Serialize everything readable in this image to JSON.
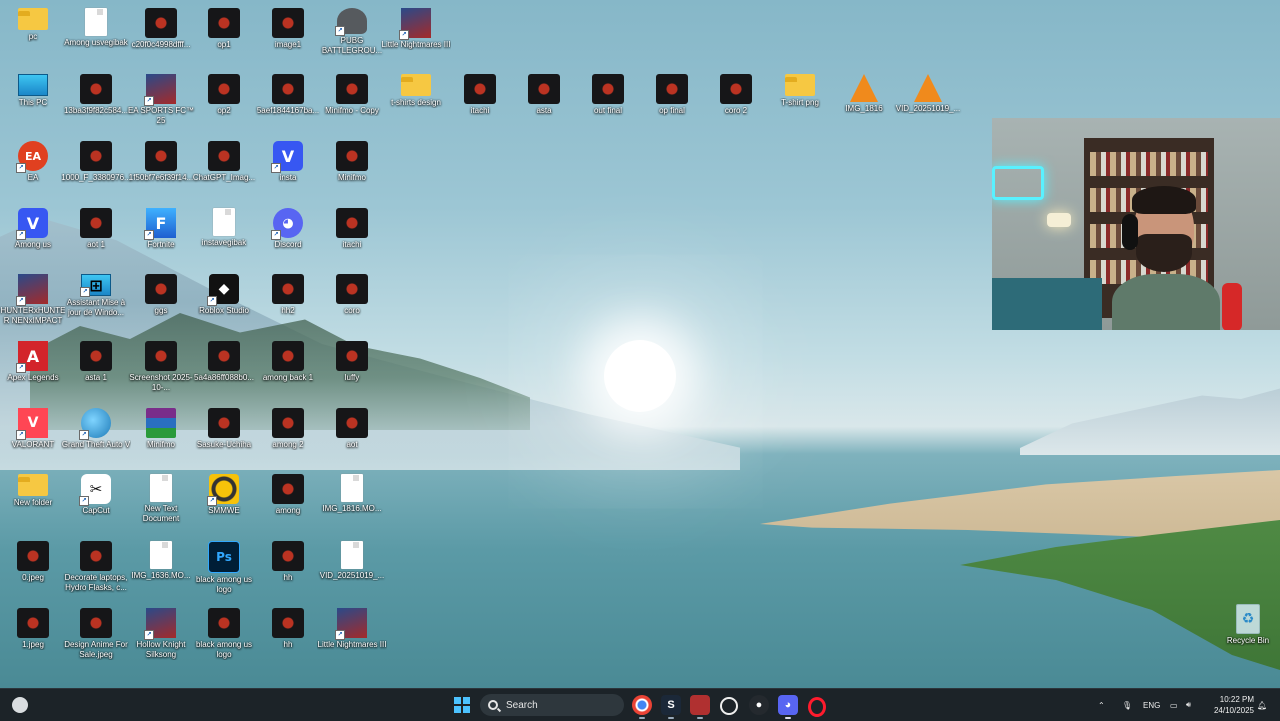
{
  "desktop": {
    "columns": [
      {
        "items": [
          {
            "label": "pc",
            "icon": "folder-icon",
            "shortcut": false
          },
          {
            "label": "This PC",
            "icon": "monitor-icon",
            "shortcut": false
          },
          {
            "label": "EA",
            "icon": "ea-icon",
            "shortcut": true
          },
          {
            "label": "Among us",
            "icon": "among-us-icon",
            "shortcut": true
          },
          {
            "label": "HUNTERxHUNTER NENxIMPACT",
            "icon": "game-icon",
            "shortcut": true
          },
          {
            "label": "Apex Legends",
            "icon": "apex-icon",
            "shortcut": true
          },
          {
            "label": "VALORANT",
            "icon": "valorant-icon",
            "shortcut": true
          },
          {
            "label": "New folder",
            "icon": "folder-icon",
            "shortcut": false
          },
          {
            "label": "0.jpeg",
            "icon": "image-icon",
            "shortcut": false
          },
          {
            "label": "1.jpeg",
            "icon": "image-icon",
            "shortcut": false
          }
        ]
      },
      {
        "items": [
          {
            "label": "Among usvegibak",
            "icon": "document-icon",
            "shortcut": false
          },
          {
            "label": "13ba3f9f82c584...",
            "icon": "image-icon",
            "shortcut": false
          },
          {
            "label": "1000_F_3380976...",
            "icon": "image-icon",
            "shortcut": false
          },
          {
            "label": "aot 1",
            "icon": "image-icon",
            "shortcut": false
          },
          {
            "label": "Assistant Mise à jour de Windo...",
            "icon": "windows-icon",
            "shortcut": true
          },
          {
            "label": "asta 1",
            "icon": "image-icon",
            "shortcut": false
          },
          {
            "label": "Grand Theft Auto V",
            "icon": "globe-icon",
            "shortcut": true
          },
          {
            "label": "CapCut",
            "icon": "capcut-icon",
            "shortcut": true
          },
          {
            "label": "Decorate laptops, Hydro Flasks, c...",
            "icon": "image-icon",
            "shortcut": false
          },
          {
            "label": "Design Anime For Sale.jpeg",
            "icon": "image-icon",
            "shortcut": false
          }
        ]
      },
      {
        "items": [
          {
            "label": "c20f0c4998dfff...",
            "icon": "image-icon",
            "shortcut": false
          },
          {
            "label": "EA SPORTS FC™ 25",
            "icon": "game-icon",
            "shortcut": true
          },
          {
            "label": "1f50bf7e6f39f14...",
            "icon": "image-icon",
            "shortcut": false
          },
          {
            "label": "Fortnite",
            "icon": "fortnite-icon",
            "shortcut": true
          },
          {
            "label": "ggs",
            "icon": "image-icon",
            "shortcut": false
          },
          {
            "label": "Screenshot 2025-10-...",
            "icon": "image-icon",
            "shortcut": false
          },
          {
            "label": "Minifmo",
            "icon": "winrar-icon",
            "shortcut": false
          },
          {
            "label": "New Text Document",
            "icon": "document-icon",
            "shortcut": false
          },
          {
            "label": "IMG_1636.MO...",
            "icon": "document-icon",
            "shortcut": false
          },
          {
            "label": "Hollow Knight Silksong",
            "icon": "game-icon",
            "shortcut": true
          }
        ]
      },
      {
        "items": [
          {
            "label": "op1",
            "icon": "image-icon",
            "shortcut": false
          },
          {
            "label": "op2",
            "icon": "image-icon",
            "shortcut": false
          },
          {
            "label": "ChatGPT_Imag...",
            "icon": "image-icon",
            "shortcut": false
          },
          {
            "label": "instavegibak",
            "icon": "document-icon",
            "shortcut": false
          },
          {
            "label": "Roblox Studio",
            "icon": "roblox-icon",
            "shortcut": true
          },
          {
            "label": "5a4a86ff088b0...",
            "icon": "image-icon",
            "shortcut": false
          },
          {
            "label": "Sasuke-Uchiha",
            "icon": "image-icon",
            "shortcut": false
          },
          {
            "label": "SMMWE",
            "icon": "smmwe-icon",
            "shortcut": true
          },
          {
            "label": "black among us logo",
            "icon": "photoshop-icon",
            "shortcut": false
          },
          {
            "label": "black among us logo",
            "icon": "image-icon",
            "shortcut": false
          }
        ]
      },
      {
        "items": [
          {
            "label": "image1",
            "icon": "image-icon",
            "shortcut": false
          },
          {
            "label": "5aef1844167ba...",
            "icon": "image-icon",
            "shortcut": false
          },
          {
            "label": "insta",
            "icon": "insta-icon",
            "shortcut": true
          },
          {
            "label": "Discord",
            "icon": "discord-icon",
            "shortcut": true
          },
          {
            "label": "hh2",
            "icon": "image-icon",
            "shortcut": false
          },
          {
            "label": "among back 1",
            "icon": "image-icon",
            "shortcut": false
          },
          {
            "label": "among 2",
            "icon": "image-icon",
            "shortcut": false
          },
          {
            "label": "among",
            "icon": "image-icon",
            "shortcut": false
          },
          {
            "label": "hh",
            "icon": "image-icon",
            "shortcut": false
          },
          {
            "label": "hh",
            "icon": "image-icon",
            "shortcut": false
          }
        ]
      },
      {
        "items": [
          {
            "label": "PUBG BATTLEGROU...",
            "icon": "pubg-icon",
            "shortcut": true
          },
          {
            "label": "Minifmo - Copy",
            "icon": "image-icon",
            "shortcut": false
          },
          {
            "label": "Minifmo",
            "icon": "image-icon",
            "shortcut": false
          },
          {
            "label": "itachi",
            "icon": "image-icon",
            "shortcut": false
          },
          {
            "label": "coro",
            "icon": "image-icon",
            "shortcut": false
          },
          {
            "label": "luffy",
            "icon": "image-icon",
            "shortcut": false
          },
          {
            "label": "aot",
            "icon": "image-icon",
            "shortcut": false
          },
          {
            "label": "IMG_1816.MO...",
            "icon": "document-icon",
            "shortcut": false
          },
          {
            "label": "VID_20251019_...",
            "icon": "document-icon",
            "shortcut": false
          },
          {
            "label": "Little Nightmares III",
            "icon": "game-icon",
            "shortcut": true
          }
        ]
      }
    ],
    "top_row_extra": [
      {
        "label": "Little Nightmares III",
        "icon": "game-icon",
        "shortcut": true
      }
    ],
    "row2_extra": [
      {
        "label": "t-shirts design",
        "icon": "folder-icon"
      },
      {
        "label": "itachi",
        "icon": "image-icon"
      },
      {
        "label": "asta",
        "icon": "image-icon"
      },
      {
        "label": "out final",
        "icon": "image-icon"
      },
      {
        "label": "op final",
        "icon": "image-icon"
      },
      {
        "label": "coro 2",
        "icon": "image-icon"
      },
      {
        "label": "T-shirt png",
        "icon": "folder-icon"
      },
      {
        "label": "IMG_1816",
        "icon": "vlc-icon"
      },
      {
        "label": "VID_20251019_...",
        "icon": "vlc-icon"
      }
    ],
    "recycle_bin": {
      "label": "Recycle Bin",
      "icon": "recycle-bin-icon"
    }
  },
  "taskbar": {
    "search_placeholder": "Search",
    "apps": [
      "chrome-icon",
      "steam-icon",
      "capture-icon",
      "chatgpt-icon",
      "github-icon",
      "discord-icon",
      "opera-icon"
    ],
    "tray": {
      "language": "ENG"
    },
    "clock": {
      "time": "10:22 PM",
      "date": "24/10/2025"
    }
  }
}
